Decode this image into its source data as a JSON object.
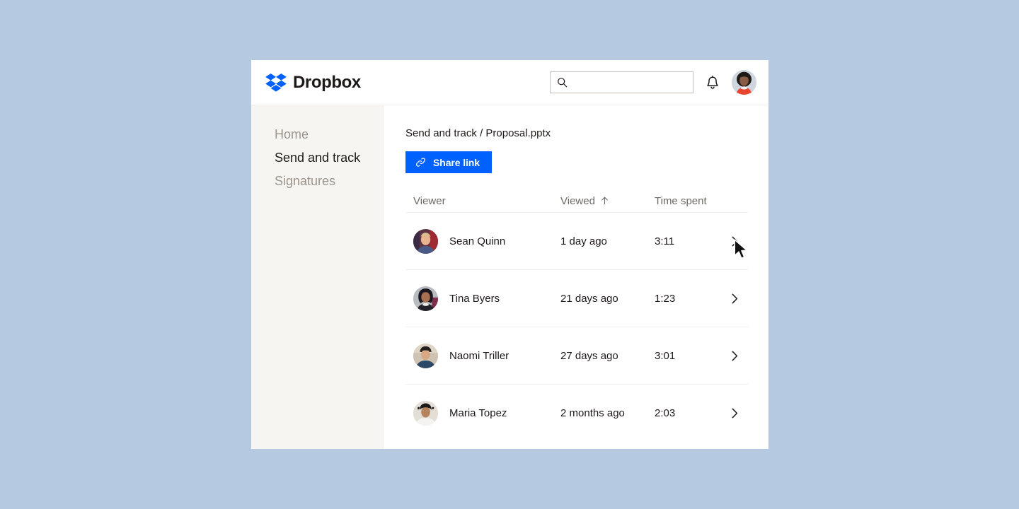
{
  "page": {
    "background_color": "#b5c9e1"
  },
  "topbar": {
    "brand_name": "Dropbox",
    "brand_color": "#0061fe",
    "search": {
      "value": "",
      "placeholder": ""
    },
    "notifications_label": "Notifications",
    "account_label": "Account"
  },
  "sidebar": {
    "items": [
      {
        "label": "Home",
        "active": false
      },
      {
        "label": "Send and track",
        "active": true
      },
      {
        "label": "Signatures",
        "active": false
      }
    ]
  },
  "main": {
    "breadcrumb": "Send and track / Proposal.pptx",
    "share_button": {
      "label": "Share link",
      "color": "#0061fe"
    },
    "table": {
      "headers": {
        "viewer": "Viewer",
        "viewed": "Viewed",
        "viewed_sort": "↑",
        "time_spent": "Time spent"
      },
      "rows": [
        {
          "name": "Sean Quinn",
          "viewed": "1 day ago",
          "time_spent": "3:11"
        },
        {
          "name": "Tina Byers",
          "viewed": "21 days ago",
          "time_spent": "1:23"
        },
        {
          "name": "Naomi Triller",
          "viewed": "27 days ago",
          "time_spent": "3:01"
        },
        {
          "name": "Maria Topez",
          "viewed": "2 months ago",
          "time_spent": "2:03"
        }
      ]
    }
  }
}
